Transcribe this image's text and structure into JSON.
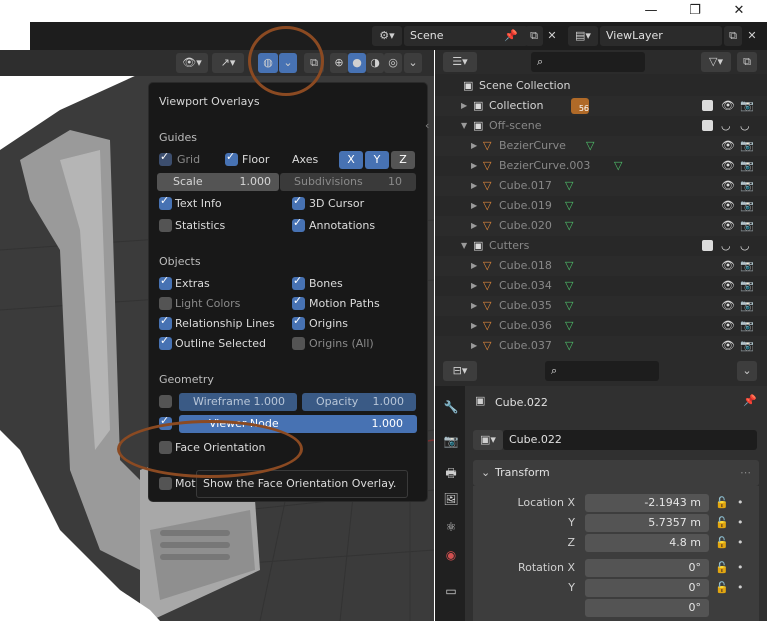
{
  "topbar": {
    "scene_label": "Scene",
    "viewlayer_label": "ViewLayer"
  },
  "overlay": {
    "title": "Viewport Overlays",
    "guides": {
      "heading": "Guides",
      "grid": "Grid",
      "floor": "Floor",
      "axes": "Axes",
      "axis_x": "X",
      "axis_y": "Y",
      "axis_z": "Z",
      "scale_label": "Scale",
      "scale_value": "1.000",
      "subdivisions_label": "Subdivisions",
      "subdivisions_value": "10",
      "text_info": "Text Info",
      "cursor_3d": "3D Cursor",
      "statistics": "Statistics",
      "annotations": "Annotations"
    },
    "objects": {
      "heading": "Objects",
      "extras": "Extras",
      "bones": "Bones",
      "light_colors": "Light Colors",
      "motion_paths": "Motion Paths",
      "relationship_lines": "Relationship Lines",
      "origins": "Origins",
      "outline_selected": "Outline Selected",
      "origins_all": "Origins (All)"
    },
    "geometry": {
      "heading": "Geometry",
      "wireframe_label": "Wireframe",
      "wireframe_value": "1.000",
      "opacity_label": "Opacity",
      "opacity_value": "1.000",
      "viewer_node_label": "Viewer Node",
      "viewer_node_value": "1.000",
      "face_orientation": "Face Orientation",
      "motion_partial": "Mot"
    },
    "tooltip": "Show the Face Orientation Overlay."
  },
  "outliner": {
    "items": [
      {
        "name": "Scene Collection",
        "indent": 0,
        "type": "scene"
      },
      {
        "name": "Collection",
        "indent": 1,
        "type": "collection",
        "badge": "56"
      },
      {
        "name": "Off-scene",
        "indent": 1,
        "type": "collection-dim"
      },
      {
        "name": "BezierCurve",
        "indent": 2,
        "type": "obj"
      },
      {
        "name": "BezierCurve.003",
        "indent": 2,
        "type": "obj"
      },
      {
        "name": "Cube.017",
        "indent": 2,
        "type": "obj"
      },
      {
        "name": "Cube.019",
        "indent": 2,
        "type": "obj"
      },
      {
        "name": "Cube.020",
        "indent": 2,
        "type": "obj"
      },
      {
        "name": "Cutters",
        "indent": 1,
        "type": "collection-dim"
      },
      {
        "name": "Cube.018",
        "indent": 2,
        "type": "obj"
      },
      {
        "name": "Cube.034",
        "indent": 2,
        "type": "obj"
      },
      {
        "name": "Cube.035",
        "indent": 2,
        "type": "obj"
      },
      {
        "name": "Cube.036",
        "indent": 2,
        "type": "obj"
      },
      {
        "name": "Cube.037",
        "indent": 2,
        "type": "obj"
      }
    ]
  },
  "properties": {
    "object_name": "Cube.022",
    "datablock_name": "Cube.022",
    "transform_heading": "Transform",
    "location_x_label": "Location X",
    "location_x": "-2.1943 m",
    "y_label": "Y",
    "location_y": "5.7357 m",
    "z_label": "Z",
    "location_z": "4.8 m",
    "rotation_x_label": "Rotation X",
    "rotation_x": "0°",
    "rotation_y": "0°",
    "rotation_z": "0°"
  },
  "colors": {
    "accent": "#4772b3",
    "annotation": "#8b4a22",
    "object_icon": "#e48a3c",
    "mesh_data_icon": "#4fc26b"
  }
}
